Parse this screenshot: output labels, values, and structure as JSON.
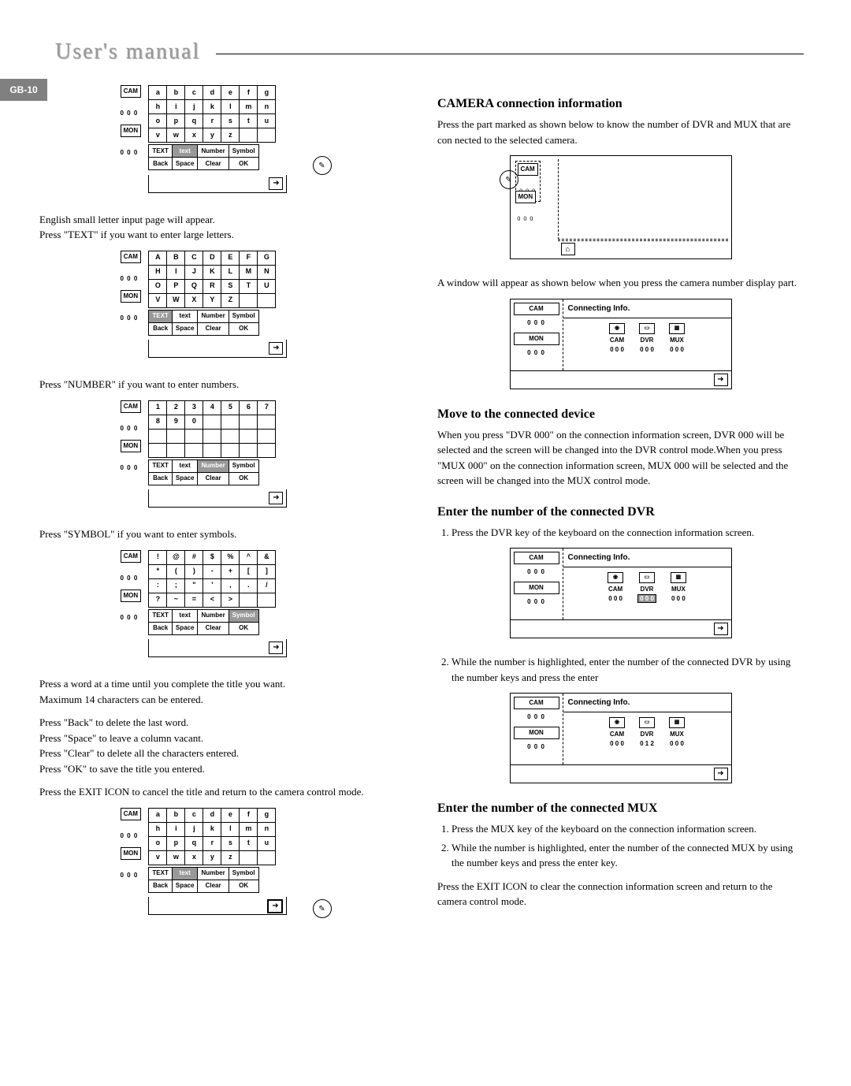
{
  "header": {
    "title": "User's manual"
  },
  "page_tab": "GB-10",
  "left": {
    "pad1": {
      "row1": [
        "a",
        "b",
        "c",
        "d",
        "e",
        "f",
        "g"
      ],
      "row2": [
        "h",
        "i",
        "j",
        "k",
        "l",
        "m",
        "n"
      ],
      "row3": [
        "o",
        "p",
        "q",
        "r",
        "s",
        "t",
        "u"
      ],
      "row4": [
        "v",
        "w",
        "x",
        "y",
        "z",
        "",
        ""
      ],
      "ctrl1": [
        "TEXT",
        "text",
        "Number",
        "Symbol"
      ],
      "ctrl2": [
        "Back",
        "Space",
        "Clear",
        "OK"
      ],
      "sel": "text"
    },
    "p1": "English small letter input page will appear.",
    "p2": "Press \"TEXT\" if you want to enter large letters.",
    "pad2": {
      "row1": [
        "A",
        "B",
        "C",
        "D",
        "E",
        "F",
        "G"
      ],
      "row2": [
        "H",
        "I",
        "J",
        "K",
        "L",
        "M",
        "N"
      ],
      "row3": [
        "O",
        "P",
        "Q",
        "R",
        "S",
        "T",
        "U"
      ],
      "row4": [
        "V",
        "W",
        "X",
        "Y",
        "Z",
        "",
        ""
      ],
      "ctrl1": [
        "TEXT",
        "text",
        "Number",
        "Symbol"
      ],
      "ctrl2": [
        "Back",
        "Space",
        "Clear",
        "OK"
      ],
      "sel": "TEXT"
    },
    "p3": "Press \"NUMBER\" if you want to enter numbers.",
    "pad3": {
      "row1": [
        "1",
        "2",
        "3",
        "4",
        "5",
        "6",
        "7"
      ],
      "row2": [
        "8",
        "9",
        "0",
        "",
        "",
        "",
        ""
      ],
      "row3": [
        "",
        "",
        "",
        "",
        "",
        "",
        ""
      ],
      "row4": [
        "",
        "",
        "",
        "",
        "",
        "",
        ""
      ],
      "ctrl1": [
        "TEXT",
        "text",
        "Number",
        "Symbol"
      ],
      "ctrl2": [
        "Back",
        "Space",
        "Clear",
        "OK"
      ],
      "sel": "Number"
    },
    "p4": "Press \"SYMBOL\" if you want to enter symbols.",
    "pad4": {
      "row1": [
        "!",
        "@",
        "#",
        "$",
        "%",
        "^",
        "&"
      ],
      "row2": [
        "*",
        "(",
        ")",
        "-",
        "+",
        "[",
        "]"
      ],
      "row3": [
        ":",
        ";",
        "\"",
        "'",
        ",",
        ".",
        "/"
      ],
      "row4": [
        "?",
        "~",
        "=",
        "<",
        ">",
        "",
        ""
      ],
      "ctrl1": [
        "TEXT",
        "text",
        "Number",
        "Symbol"
      ],
      "ctrl2": [
        "Back",
        "Space",
        "Clear",
        "OK"
      ],
      "sel": "Symbol"
    },
    "p5": "Press a word at a time until you complete the title you want.",
    "p6": "Maximum 14 characters can be entered.",
    "p7": "Press \"Back\" to delete the last word.",
    "p8": "Press \"Space\" to leave a column vacant.",
    "p9": "Press \"Clear\" to delete all the characters entered.",
    "p10": "Press \"OK\" to save the title you entered.",
    "p11": "Press the EXIT ICON to cancel the title and return to the camera control mode.",
    "pad5": {
      "row1": [
        "a",
        "b",
        "c",
        "d",
        "e",
        "f",
        "g"
      ],
      "row2": [
        "h",
        "i",
        "j",
        "k",
        "l",
        "m",
        "n"
      ],
      "row3": [
        "o",
        "p",
        "q",
        "r",
        "s",
        "t",
        "u"
      ],
      "row4": [
        "v",
        "w",
        "x",
        "y",
        "z",
        "",
        ""
      ],
      "ctrl1": [
        "TEXT",
        "text",
        "Number",
        "Symbol"
      ],
      "ctrl2": [
        "Back",
        "Space",
        "Clear",
        "OK"
      ],
      "sel": "text"
    },
    "side": {
      "cam": "CAM",
      "camv": "0 0 0",
      "mon": "MON",
      "monv": "0 0 0"
    }
  },
  "right": {
    "h1": "CAMERA connection information",
    "p1": "Press the part marked as shown below to know the number of DVR and MUX that are con nected to the selected camera.",
    "p2": "A window will appear as shown below when you press the camera number display part.",
    "conn_title": "Connecting Info.",
    "dev": {
      "cam": "CAM",
      "camv": "0 0 0",
      "dvr": "DVR",
      "dvrv": "0 0 0",
      "mux": "MUX",
      "muxv": "0 0 0"
    },
    "h2": "Move to the connected device",
    "p3": "When you press \"DVR 000\" on the connection information screen, DVR 000 will be selected and the screen will be changed into the DVR control mode.When you press \"MUX 000\" on the connection information screen, MUX 000 will be selected and the screen will be changed into the MUX control mode.",
    "h3": "Enter the number of the connected DVR",
    "step1": "Press the DVR key of the keyboard on the connection information screen.",
    "step2": "While the number is highlighted, enter the number of the connected DVR by using the number keys and press the enter",
    "dev2": {
      "dvrv": "0 1 2"
    },
    "h4": "Enter the number of the connected MUX",
    "step3": "Press the MUX key of the keyboard on the connection information screen.",
    "step4": "While the number is highlighted, enter the number of the connected MUX by using the number keys and press the enter key.",
    "p4": "Press the EXIT ICON to clear the connection information screen and return to the camera control  mode."
  }
}
